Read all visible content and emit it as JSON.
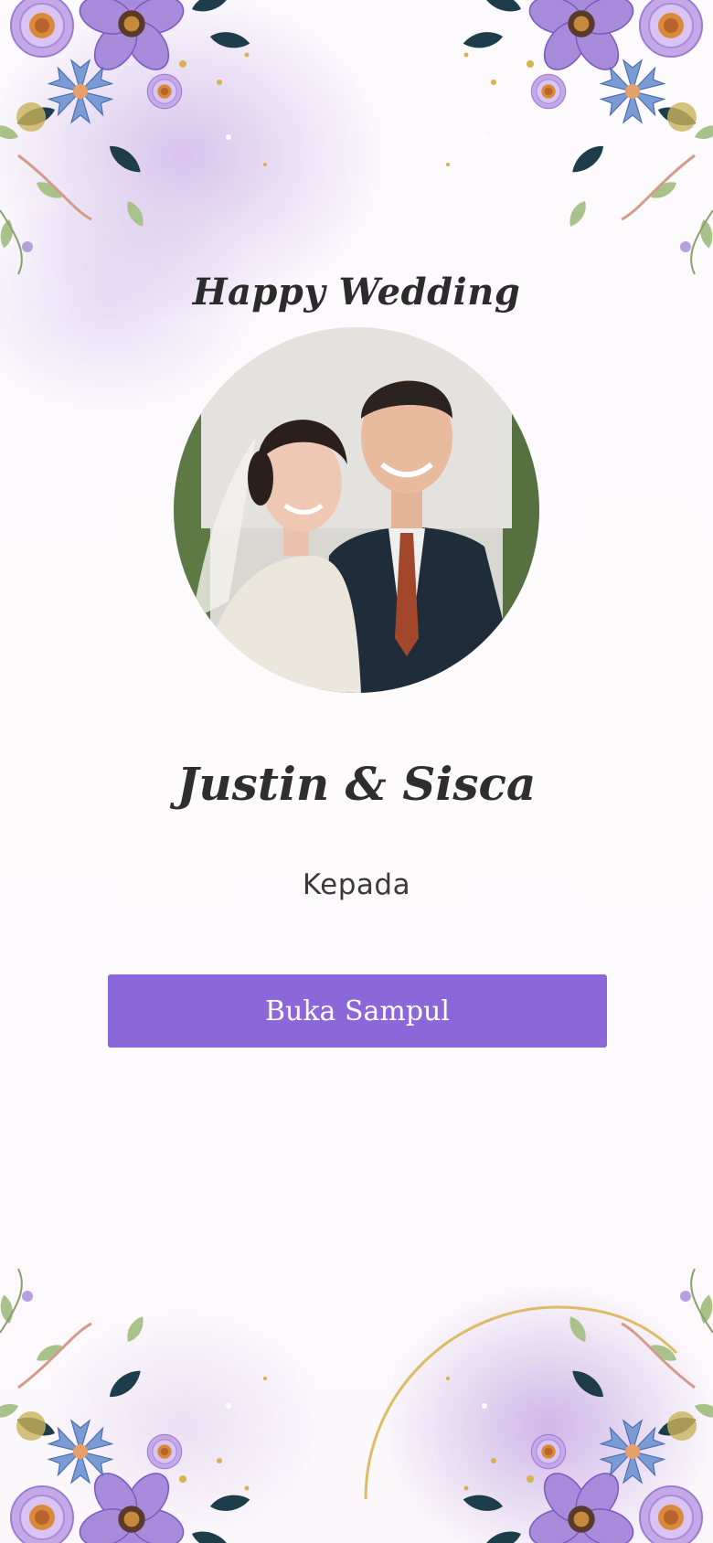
{
  "cover": {
    "heading": "Happy Wedding",
    "couple_names": "Justin & Sisca",
    "recipient_label": "Kepada",
    "open_button_label": "Buka Sampul"
  },
  "colors": {
    "accent": "#8b67d9",
    "text": "#2e2e2e",
    "flower_purple": "#9b7ad6",
    "flower_blue": "#6b8fc9",
    "leaf_dark": "#1e3d4a",
    "gold": "#d8b24a"
  },
  "icons": {
    "decor": "floral-corner-icon",
    "photo": "couple-photo"
  }
}
